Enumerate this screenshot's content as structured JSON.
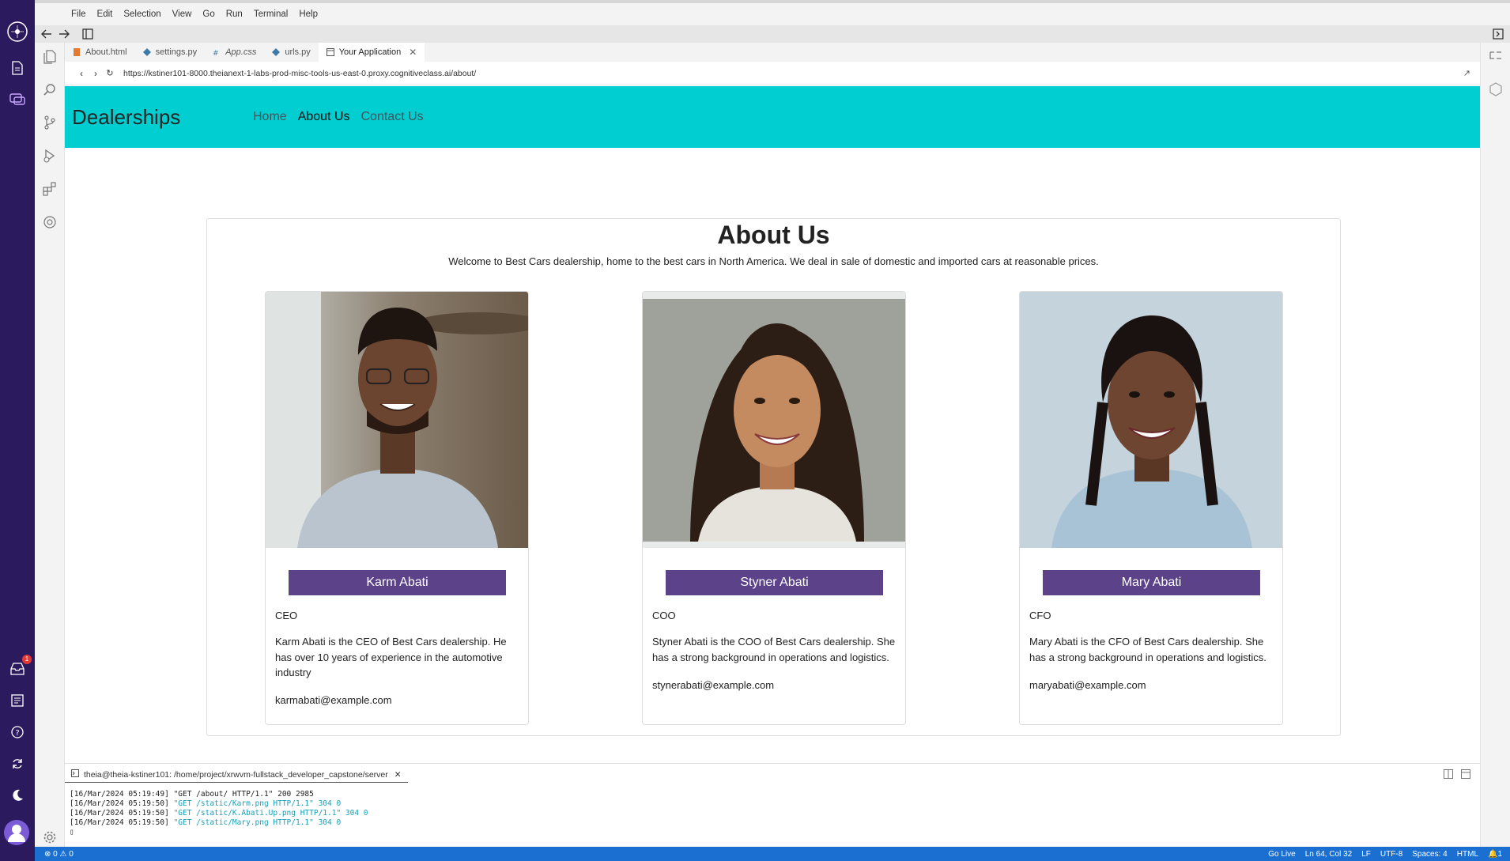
{
  "menu": [
    "File",
    "Edit",
    "Selection",
    "View",
    "Go",
    "Run",
    "Terminal",
    "Help"
  ],
  "tabs": [
    {
      "label": "About.html",
      "icon": "html-file-icon"
    },
    {
      "label": "settings.py",
      "icon": "python-file-icon"
    },
    {
      "label": "App.css",
      "icon": "css-file-icon"
    },
    {
      "label": "urls.py",
      "icon": "python-file-icon"
    },
    {
      "label": "Your Application",
      "icon": "browser-preview-icon"
    }
  ],
  "browser": {
    "url": "https://kstiner101-8000.theianext-1-labs-prod-misc-tools-us-east-0.proxy.cognitiveclass.ai/about/"
  },
  "site": {
    "brand": "Dealerships",
    "nav": [
      "Home",
      "About Us",
      "Contact Us"
    ],
    "active_nav": "About Us",
    "title": "About Us",
    "subtitle": "Welcome to Best Cars dealership, home to the best cars in North America. We deal in sale of domestic and imported cars at reasonable prices."
  },
  "team": [
    {
      "name": "Karm Abati",
      "role": "CEO",
      "bio": "Karm Abati is the CEO of Best Cars dealership. He has over 10 years of experience in the automotive industry",
      "email": "karmabati@example.com"
    },
    {
      "name": "Styner Abati",
      "role": "COO",
      "bio": "Styner Abati is the COO of Best Cars dealership. She has a strong background in operations and logistics.",
      "email": "stynerabati@example.com"
    },
    {
      "name": "Mary Abati",
      "role": "CFO",
      "bio": "Mary Abati is the CFO of Best Cars dealership. She has a strong background in operations and logistics.",
      "email": "maryabati@example.com"
    }
  ],
  "terminal": {
    "tab_label": "theia@theia-kstiner101: /home/project/xrwvm-fullstack_developer_capstone/server",
    "lines": [
      {
        "prefix": "[16/Mar/2024 05:19:49] ",
        "text": "\"GET /about/ HTTP/1.1\" 200 2985",
        "color": "#222222"
      },
      {
        "prefix": "[16/Mar/2024 05:19:50] ",
        "text": "\"GET /static/Karm.png HTTP/1.1\" 304 0",
        "color": "#16a0b6"
      },
      {
        "prefix": "[16/Mar/2024 05:19:50] ",
        "text": "\"GET /static/K.Abati.Up.png HTTP/1.1\" 304 0",
        "color": "#16a0b6"
      },
      {
        "prefix": "[16/Mar/2024 05:19:50] ",
        "text": "\"GET /static/Mary.png HTTP/1.1\" 304 0",
        "color": "#16a0b6"
      }
    ]
  },
  "statusbar": {
    "problems": "⊗ 0 ⚠ 0",
    "go_live": "Go Live",
    "position": "Ln 64, Col 32",
    "eol": "LF",
    "encoding": "UTF-8",
    "indent": "Spaces: 4",
    "language": "HTML",
    "notifications": "1"
  },
  "notification_badge": "1",
  "colors": {
    "navbar": "#00ced1",
    "name_button": "#5b4289",
    "rail": "#2c1a5e",
    "statusbar": "#1b6fd1"
  }
}
